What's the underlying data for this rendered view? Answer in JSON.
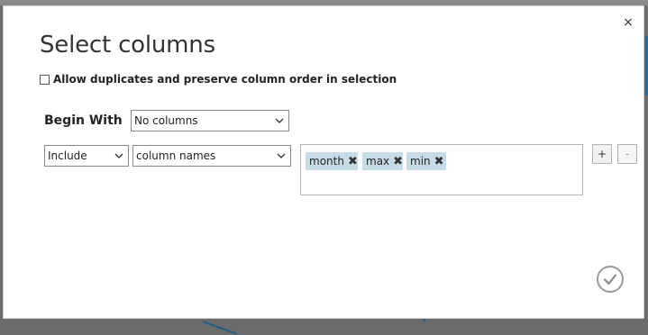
{
  "dialog": {
    "title": "Select columns",
    "close_icon_glyph": "×",
    "duplicates_checkbox": {
      "label": "Allow duplicates and preserve column order in selection",
      "checked": false
    },
    "begin_with": {
      "label": "Begin With",
      "selected": "No columns"
    },
    "rule": {
      "mode_selected": "Include",
      "type_selected": "column names",
      "tags": [
        {
          "label": "month"
        },
        {
          "label": "max"
        },
        {
          "label": "min"
        }
      ],
      "tag_remove_glyph": "✖"
    },
    "add_rule_label": "+",
    "remove_rule_label": "-",
    "icons": {
      "close": "close-icon",
      "chevron": "chevron-down-icon",
      "confirm": "checkmark-icon"
    },
    "colors": {
      "tag_bg": "#c6dbe8",
      "accent": "#1f5f86"
    }
  }
}
